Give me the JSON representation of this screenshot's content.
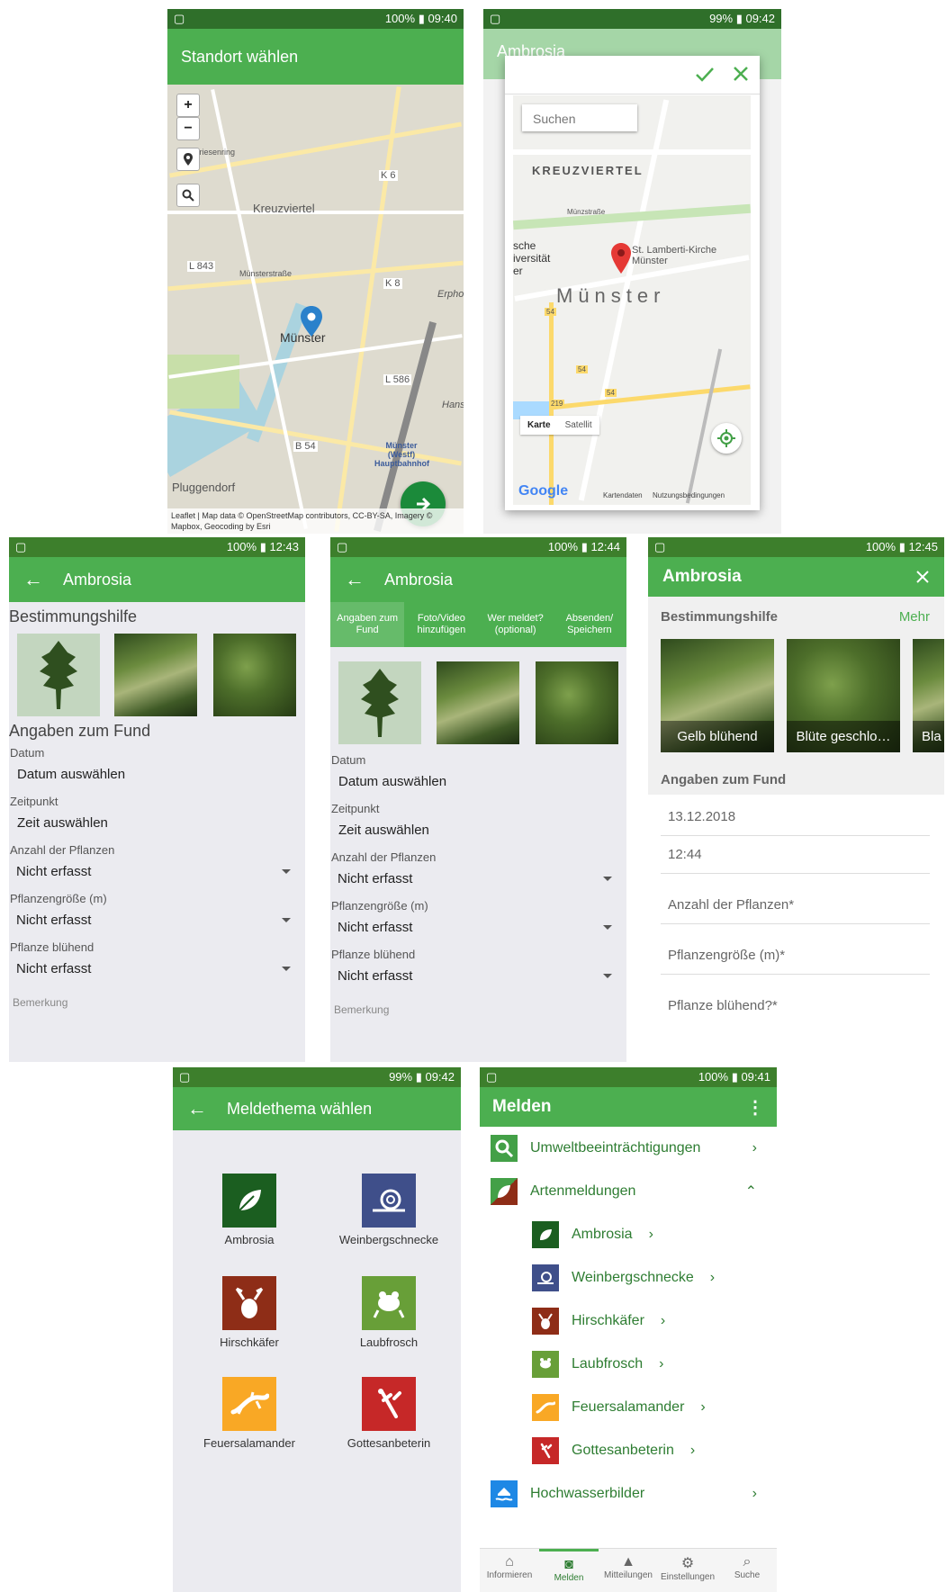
{
  "s1": {
    "status": {
      "right": "100% ▮ 09:40"
    },
    "title": "Standort wählen",
    "zoom_in": "+",
    "zoom_out": "−",
    "labels": {
      "kreuzviertel": "Kreuzviertel",
      "munster": "Münster",
      "pluggendorf": "Pluggendorf",
      "k6": "K 6",
      "k8": "K 8",
      "l843": "L 843",
      "l586": "L 586",
      "b54": "B 54",
      "friesenring": "Friesenring",
      "munsterstrasse": "Münsterstraße",
      "bahnhof": "Münster (Westf) Hauptbahnhof",
      "hans": "Hans",
      "erpho": "Erpho"
    },
    "attribution": "Leaflet | Map data © OpenStreetMap contributors, CC-BY-SA, Imagery © Mapbox, Geocoding by Esri"
  },
  "s2": {
    "status": {
      "right": "99% ▮ 09:42"
    },
    "bg_title": "Ambrosia",
    "search_placeholder": "Suchen",
    "labels": {
      "kreuzviertel": "KREUZVIERTEL",
      "munster": "Münster",
      "uni": "sche iversität er",
      "lamberti": "St. Lamberti-Kirche Münster",
      "munsterstrasse": "Münzstraße",
      "r54a": "54",
      "r54b": "54",
      "r54c": "54",
      "r219": "219"
    },
    "map_type": {
      "karte": "Karte",
      "satellit": "Satellit"
    },
    "google": "Google",
    "footer": {
      "kartendaten": "Kartendaten",
      "nutzung": "Nutzungsbedingungen"
    }
  },
  "s3": {
    "status": {
      "right": "100% ▮ 12:43"
    },
    "title": "Ambrosia",
    "section1": "Bestimmungshilfe",
    "section2": "Angaben zum Fund",
    "datum_label": "Datum",
    "datum_value": "Datum auswählen",
    "zeit_label": "Zeitpunkt",
    "zeit_value": "Zeit auswählen",
    "anzahl_label": "Anzahl der Pflanzen",
    "anzahl_value": "Nicht erfasst",
    "groesse_label": "Pflanzengröße (m)",
    "groesse_value": "Nicht erfasst",
    "bluehend_label": "Pflanze blühend",
    "bluehend_value": "Nicht erfasst",
    "bemerkung": "Bemerkung"
  },
  "s4": {
    "status": {
      "right": "100% ▮ 12:44"
    },
    "title": "Ambrosia",
    "tabs": [
      "Angaben zum Fund",
      "Foto/Video hinzufügen",
      "Wer meldet? (optional)",
      "Absenden/ Speichern"
    ],
    "datum_label": "Datum",
    "datum_value": "Datum auswählen",
    "zeit_label": "Zeitpunkt",
    "zeit_value": "Zeit auswählen",
    "anzahl_label": "Anzahl der Pflanzen",
    "anzahl_value": "Nicht erfasst",
    "groesse_label": "Pflanzengröße (m)",
    "groesse_value": "Nicht erfasst",
    "bluehend_label": "Pflanze blühend",
    "bluehend_value": "Nicht erfasst",
    "bemerkung": "Bemerkung"
  },
  "s5": {
    "status": {
      "right": "100% ▮ 12:45"
    },
    "title": "Ambrosia",
    "section1": "Bestimmungshilfe",
    "mehr": "Mehr",
    "cards": [
      "Gelb blühend",
      "Blüte geschlo…",
      "Bla"
    ],
    "section2": "Angaben zum Fund",
    "date": "13.12.2018",
    "time": "12:44",
    "anzahl": "Anzahl der Pflanzen*",
    "groesse": "Pflanzengröße (m)*",
    "bluehend": "Pflanze blühend?*"
  },
  "s6": {
    "status": {
      "right": "99% ▮ 09:42"
    },
    "title": "Meldethema wählen",
    "items": [
      "Ambrosia",
      "Weinbergschnecke",
      "Hirschkäfer",
      "Laubfrosch",
      "Feuersalamander",
      "Gottesanbeterin"
    ]
  },
  "s7": {
    "status": {
      "right": "100% ▮ 09:41"
    },
    "title": "Melden",
    "menu": "⋮",
    "rows": {
      "umwelt": "Umweltbeeinträchtigungen",
      "arten": "Artenmeldungen",
      "hochwasser": "Hochwasserbilder"
    },
    "sub": [
      "Ambrosia",
      "Weinbergschnecke",
      "Hirschkäfer",
      "Laubfrosch",
      "Feuersalamander",
      "Gottesanbeterin"
    ],
    "nav": [
      "Informieren",
      "Melden",
      "Mitteilungen",
      "Einstellungen",
      "Suche"
    ]
  },
  "colors": {
    "green": "#4caf50",
    "dark_green": "#3d7f2c",
    "text_green": "#2e7d32"
  }
}
